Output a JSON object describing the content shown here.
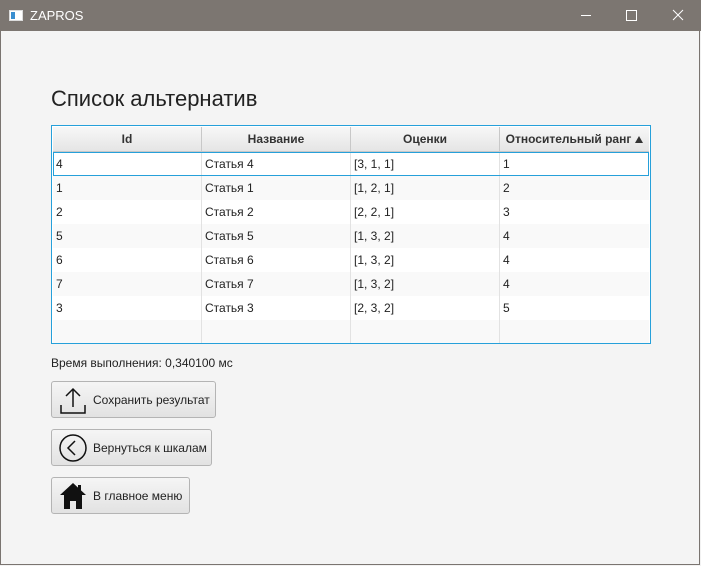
{
  "window": {
    "title": "ZAPROS"
  },
  "heading": "Список альтернатив",
  "table": {
    "columns": [
      "Id",
      "Название",
      "Оценки",
      "Относительный ранг"
    ],
    "sort_column": "Относительный ранг",
    "sort_direction": "ascending",
    "rows": [
      [
        "4",
        "Статья 4",
        "[3, 1, 1]",
        "1"
      ],
      [
        "1",
        "Статья 1",
        "[1, 2, 1]",
        "2"
      ],
      [
        "2",
        "Статья 2",
        "[2, 2, 1]",
        "3"
      ],
      [
        "5",
        "Статья 5",
        "[1, 3, 2]",
        "4"
      ],
      [
        "6",
        "Статья 6",
        "[1, 3, 2]",
        "4"
      ],
      [
        "7",
        "Статья 7",
        "[1, 3, 2]",
        "4"
      ],
      [
        "3",
        "Статья 3",
        "[2, 3, 2]",
        "5"
      ]
    ]
  },
  "exec_time": "Время выполнения: 0,340100 мс",
  "buttons": {
    "save": {
      "label": "Сохранить результат",
      "icon": "upload-icon"
    },
    "back": {
      "label": "Вернуться к шкалам",
      "icon": "chevron-left-circle-icon"
    },
    "home": {
      "label": "В главное меню",
      "icon": "home-icon"
    }
  },
  "colors": {
    "titlebar": "#7c7671",
    "accent": "#26a0da"
  }
}
